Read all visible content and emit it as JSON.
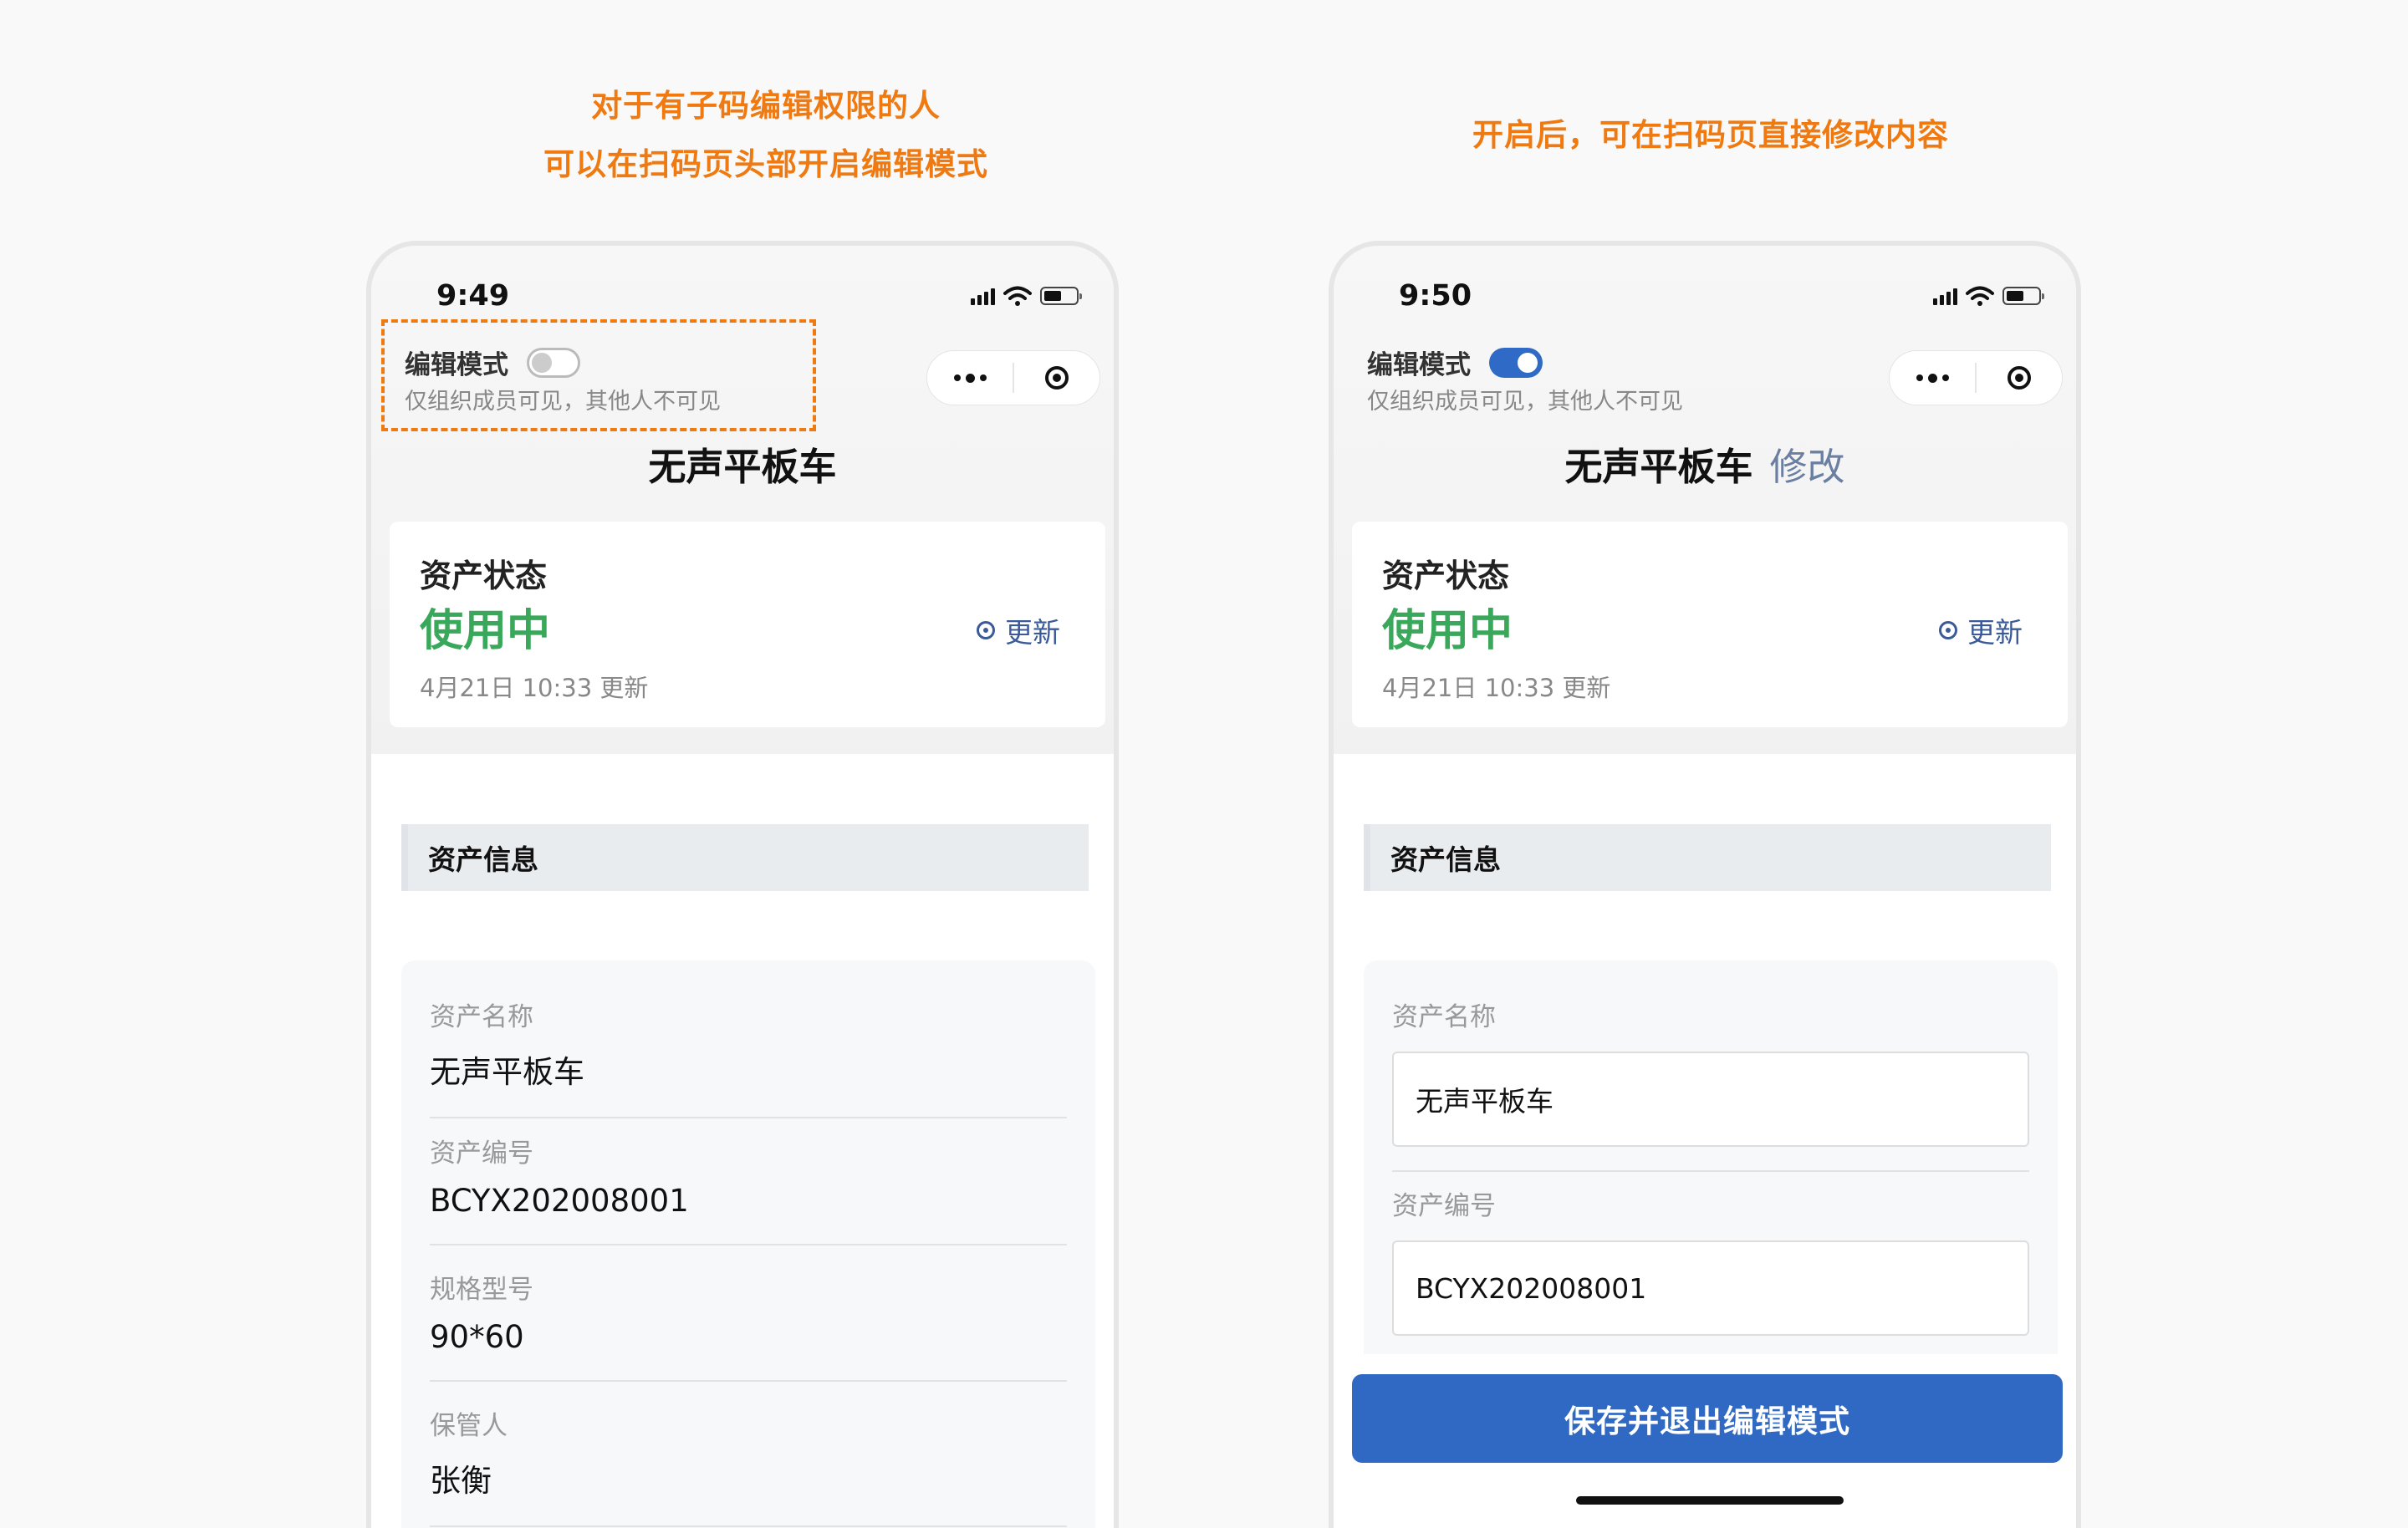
{
  "captions": {
    "left_line1": "对于有子码编辑权限的人",
    "left_line2": "可以在扫码页头部开启编辑模式",
    "right": "开启后，可在扫码页直接修改内容"
  },
  "left_phone": {
    "time": "9:49",
    "edit_mode_label": "编辑模式",
    "edit_mode_on": false,
    "edit_mode_sub": "仅组织成员可见，其他人不可见",
    "title": "无声平板车",
    "status_label": "资产状态",
    "status_value": "使用中",
    "update_button": "更新",
    "update_time": "4月21日 10:33 更新",
    "section_title": "资产信息",
    "fields": [
      {
        "label": "资产名称",
        "value": "无声平板车"
      },
      {
        "label": "资产编号",
        "value": "BCYX202008001"
      },
      {
        "label": "规格型号",
        "value": "90*60"
      },
      {
        "label": "保管人",
        "value": "张衡"
      }
    ]
  },
  "right_phone": {
    "time": "9:50",
    "edit_mode_label": "编辑模式",
    "edit_mode_on": true,
    "edit_mode_sub": "仅组织成员可见，其他人不可见",
    "title": "无声平板车",
    "title_edit_link": "修改",
    "status_label": "资产状态",
    "status_value": "使用中",
    "update_button": "更新",
    "update_time": "4月21日 10:33 更新",
    "section_title": "资产信息",
    "fields": [
      {
        "label": "资产名称",
        "value": "无声平板车"
      },
      {
        "label": "资产编号",
        "value": "BCYX202008001"
      }
    ],
    "save_button": "保存并退出编辑模式"
  },
  "colors": {
    "accent_orange": "#f07a12",
    "status_green": "#3aa85a",
    "primary_blue": "#2f69c3",
    "link_blue": "#3b5a99"
  }
}
